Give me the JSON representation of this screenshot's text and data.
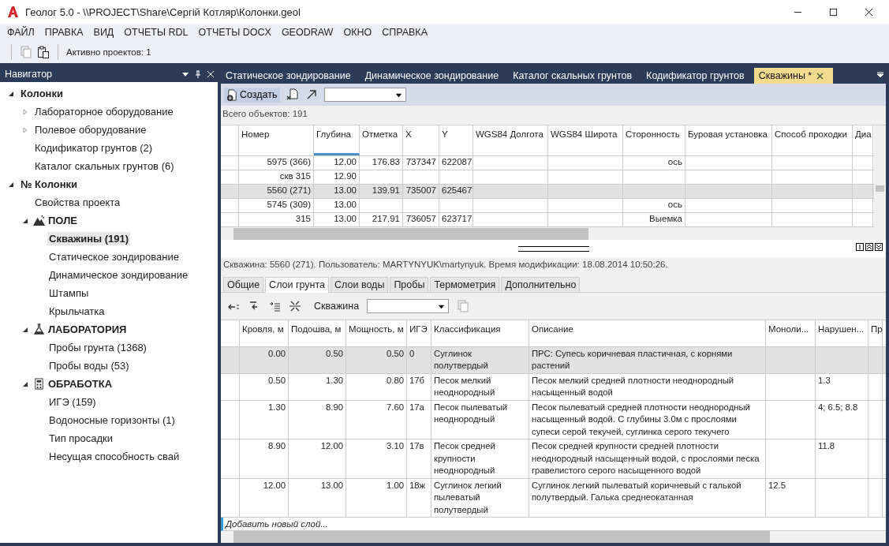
{
  "window": {
    "title": "Геолог 5.0 - \\\\PROJECT\\Share\\Сергій Котляр\\Колонки.geol"
  },
  "menu": [
    "ФАЙЛ",
    "ПРАВКА",
    "ВИД",
    "ОТЧЕТЫ RDL",
    "ОТЧЕТЫ DOCX",
    "GEODRAW",
    "ОКНО",
    "СПРАВКА"
  ],
  "toolbar": {
    "copy_disabled": true,
    "status": "Активно проектов: 1"
  },
  "navigator": {
    "title": "Навигатор",
    "items": [
      {
        "label": "Колонки",
        "bold": true,
        "selected": false,
        "expanded": true,
        "children": [
          {
            "label": "Лабораторное оборудование",
            "selected": false,
            "expanded": false
          },
          {
            "label": "Полевое оборудование",
            "selected": false,
            "expanded": false
          },
          {
            "label": "Кодификатор грунтов (2)",
            "selected": false
          },
          {
            "label": "Каталог скальных грунтов (6)",
            "selected": false
          }
        ]
      },
      {
        "label": "№ Колонки",
        "bold": true,
        "selected": false,
        "expanded": true,
        "children": [
          {
            "label": "Свойства проекта",
            "selected": false
          },
          {
            "label": "ПОЛЕ",
            "bold": true,
            "kind": "field",
            "selected": false,
            "expanded": true,
            "children": [
              {
                "label": "Скважины (191)",
                "selected": true
              },
              {
                "label": "Статическое зондирование",
                "selected": false
              },
              {
                "label": "Динамическое зондирование",
                "selected": false
              },
              {
                "label": "Штампы",
                "selected": false
              },
              {
                "label": "Крыльчатка",
                "selected": false
              }
            ]
          },
          {
            "label": "ЛАБОРАТОРИЯ",
            "bold": true,
            "kind": "lab",
            "selected": false,
            "expanded": true,
            "children": [
              {
                "label": "Пробы грунта (1368)",
                "selected": false
              },
              {
                "label": "Пробы воды (53)",
                "selected": false
              }
            ]
          },
          {
            "label": "ОБРАБОТКА",
            "bold": true,
            "kind": "calc",
            "selected": false,
            "expanded": true,
            "children": [
              {
                "label": "ИГЭ (159)",
                "selected": false
              },
              {
                "label": "Водоносные горизонты (1)",
                "selected": false
              },
              {
                "label": "Тип просадки",
                "selected": false
              },
              {
                "label": "Несущая способность свай",
                "selected": false
              }
            ]
          }
        ]
      }
    ]
  },
  "doc_tabs": [
    {
      "label": "Статическое зондирование",
      "selected": false
    },
    {
      "label": "Динамическое зондирование",
      "selected": false
    },
    {
      "label": "Каталог скальных грунтов",
      "selected": false
    },
    {
      "label": "Кодификатор грунтов",
      "selected": false
    },
    {
      "label": "Скважины *",
      "selected": true
    }
  ],
  "create_button": "Создать",
  "total": "Всего объектов: 191",
  "wells": {
    "columns": [
      {
        "label": "Номер",
        "sorted": false
      },
      {
        "label": "Глубина",
        "sorted": true
      },
      {
        "label": "Отметка",
        "sorted": false
      },
      {
        "label": "X",
        "sorted": false
      },
      {
        "label": "Y",
        "sorted": false
      },
      {
        "label": "WGS84 Долгота",
        "sorted": false
      },
      {
        "label": "WGS84 Широта",
        "sorted": false
      },
      {
        "label": "Сторонность",
        "sorted": false
      },
      {
        "label": "Буровая установка",
        "sorted": false
      },
      {
        "label": "Способ проходки",
        "sorted": false
      },
      {
        "label": "Диа",
        "sorted": false
      }
    ],
    "rows": [
      {
        "selected": false,
        "cells": [
          "5975 (366)",
          "12.00",
          "176.83",
          "737347",
          "622087",
          "",
          "",
          "ось",
          "",
          "",
          ""
        ]
      },
      {
        "selected": false,
        "cells": [
          "скв 315",
          "12.90",
          "",
          "",
          "",
          "",
          "",
          "",
          "",
          "",
          ""
        ]
      },
      {
        "selected": true,
        "cells": [
          "5560 (271)",
          "13.00",
          "139.91",
          "735007",
          "625467",
          "",
          "",
          "",
          "",
          "",
          ""
        ]
      },
      {
        "selected": false,
        "cells": [
          "5745 (309)",
          "13.00",
          "",
          "",
          "",
          "",
          "",
          "ось",
          "",
          "",
          ""
        ]
      },
      {
        "selected": false,
        "cells": [
          "315",
          "13.00",
          "217.91",
          "736057",
          "623717",
          "",
          "",
          "Выемка",
          "",
          "",
          ""
        ]
      }
    ]
  },
  "info": "Скважина: 5560 (271). Пользователь: MARTYNYUK\\martynyuk. Время модификации: 18.08.2014 10:50:26.",
  "sub_tabs": [
    {
      "label": "Общие",
      "selected": false
    },
    {
      "label": "Слои грунта",
      "selected": true
    },
    {
      "label": "Слои воды",
      "selected": false
    },
    {
      "label": "Пробы",
      "selected": false
    },
    {
      "label": "Термометрия",
      "selected": false
    },
    {
      "label": "Дополнительно",
      "selected": false
    }
  ],
  "well_label": "Скважина",
  "layers": {
    "columns": [
      "Кровля, м",
      "Подошва, м",
      "Мощность, м",
      "ИГЭ",
      "Классификация",
      "Описание",
      "Моноли...",
      "Нарушен...",
      "Пр"
    ],
    "rows": [
      {
        "selected": true,
        "cells": [
          "0.00",
          "0.50",
          "0.50",
          "0",
          "Суглинок полутвердый",
          "ПРС: Супесь коричневая пластичная, с корнями растений",
          "",
          "",
          ""
        ]
      },
      {
        "selected": false,
        "cells": [
          "0.50",
          "1.30",
          "0.80",
          "17б",
          "Песок мелкий неоднородный",
          "Песок мелкий средней плотности неоднородный насыщенный водой",
          "",
          "1.3",
          ""
        ]
      },
      {
        "selected": false,
        "cells": [
          "1.30",
          "8.90",
          "7.60",
          "17а",
          "Песок пылеватый неоднородный",
          "Песок пылеватый средней плотности неоднородный насыщенный водой. С глубины 3.0м с прослоями супеси серой текучей, суглинка серого текучего",
          "",
          "4; 6.5; 8.8",
          ""
        ]
      },
      {
        "selected": false,
        "cells": [
          "8.90",
          "12.00",
          "3.10",
          "17в",
          "Песок средней крупности неоднородный",
          "Песок средней крупности средней плотности неоднородный насыщенный водой, с прослоями песка гравелистого серого насыщенного водой",
          "",
          "11.8",
          ""
        ]
      },
      {
        "selected": false,
        "cells": [
          "12.00",
          "13.00",
          "1.00",
          "18ж",
          "Суглинок легкий пылеватый полутвердый",
          "Суглинок легкий пылеватый коричневый с галькой полутвердый. Галька среднеокатанная",
          "12.5",
          "",
          ""
        ]
      }
    ],
    "add_row": "Добавить новый слой..."
  }
}
